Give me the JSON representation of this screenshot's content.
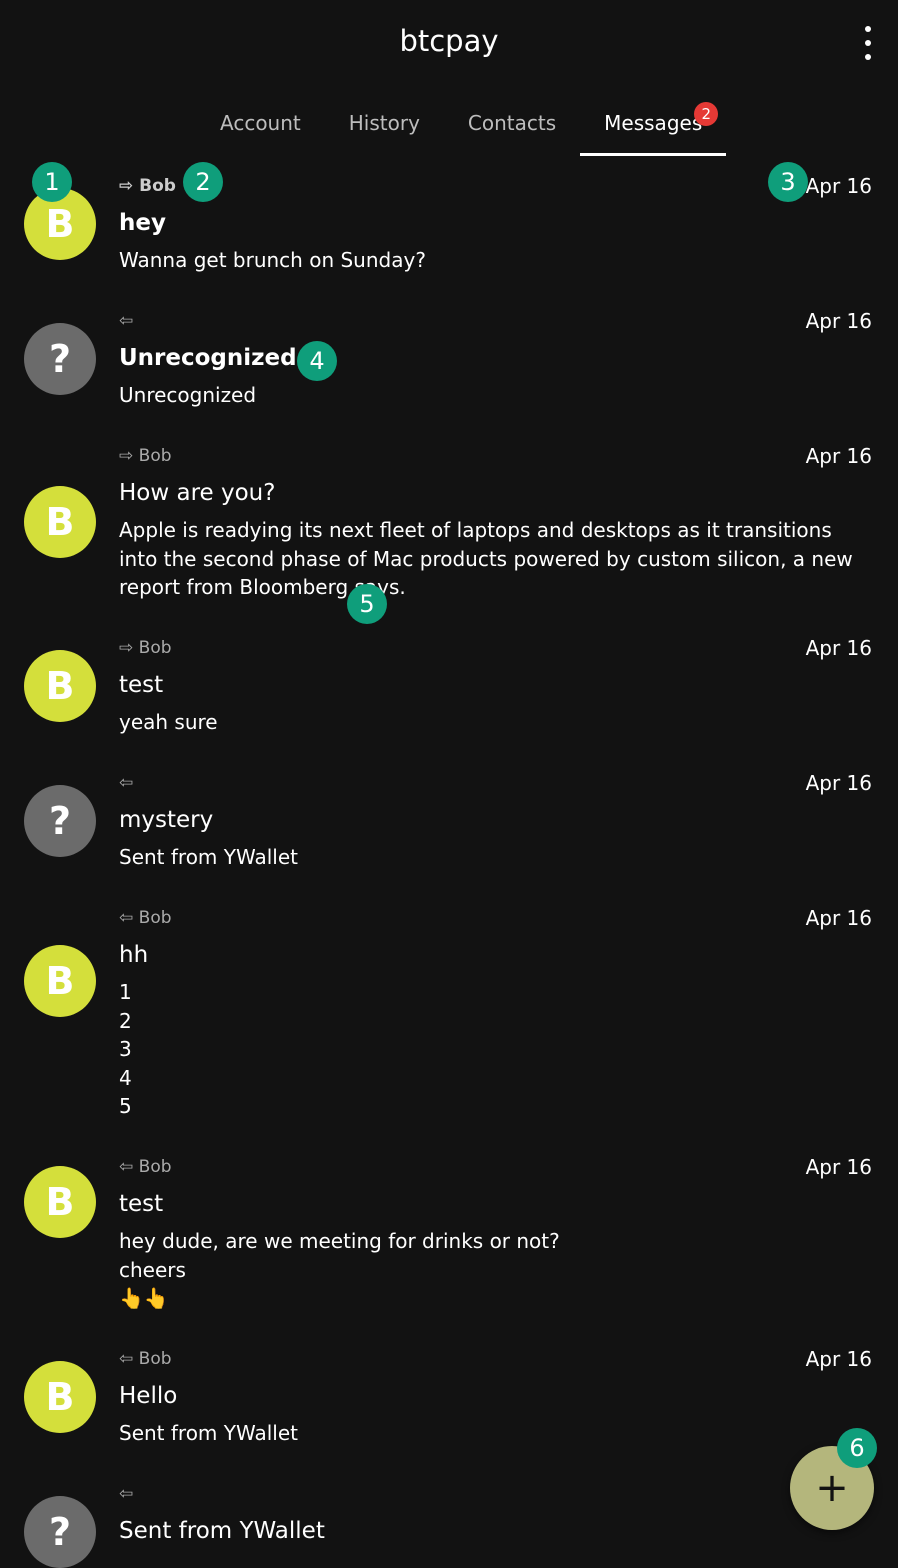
{
  "appbar": {
    "title": "btcpay",
    "menu_icon": "more-vert-icon"
  },
  "tabs": [
    {
      "label": "Account"
    },
    {
      "label": "History"
    },
    {
      "label": "Contacts"
    },
    {
      "label": "Messages",
      "badge": "2"
    }
  ],
  "messages": [
    {
      "avatar": "B",
      "direction": "⇨",
      "contact": "Bob",
      "date": "Apr 16",
      "subject": "hey",
      "body": "Wanna get brunch on Sunday?",
      "unread": true
    },
    {
      "avatar": "?",
      "direction": "⇦",
      "contact": "",
      "date": "Apr 16",
      "subject": "Unrecognized",
      "body": "Unrecognized",
      "unread": true
    },
    {
      "avatar": "B",
      "direction": "⇨",
      "contact": "Bob",
      "date": "Apr 16",
      "subject": "How are you?",
      "body": "Apple is readying its next fleet of laptops and desktops as it transitions into the second phase of Mac products powered by custom silicon, a new report from Bloomberg says."
    },
    {
      "avatar": "B",
      "direction": "⇨",
      "contact": "Bob",
      "date": "Apr 16",
      "subject": "test",
      "body": "yeah sure"
    },
    {
      "avatar": "?",
      "direction": "⇦",
      "contact": "",
      "date": "Apr 16",
      "subject": "mystery",
      "body": "Sent from YWallet"
    },
    {
      "avatar": "B",
      "direction": "⇦",
      "contact": "Bob",
      "date": "Apr 16",
      "subject": "hh",
      "body": "1\n2\n3\n4\n5"
    },
    {
      "avatar": "B",
      "direction": "⇦",
      "contact": "Bob",
      "date": "Apr 16",
      "subject": "test",
      "body": "hey dude, are we meeting for drinks or not?\ncheers\n👆👆"
    },
    {
      "avatar": "B",
      "direction": "⇦",
      "contact": "Bob",
      "date": "Apr 16",
      "subject": "Hello",
      "body": "Sent from YWallet"
    },
    {
      "avatar": "?",
      "direction": "⇦",
      "contact": "",
      "date": "",
      "subject": "Sent from YWallet",
      "body": ""
    }
  ],
  "fab": {
    "label": "+",
    "icon": "add-icon"
  },
  "annotations": [
    "1",
    "2",
    "3",
    "4",
    "5",
    "6"
  ]
}
